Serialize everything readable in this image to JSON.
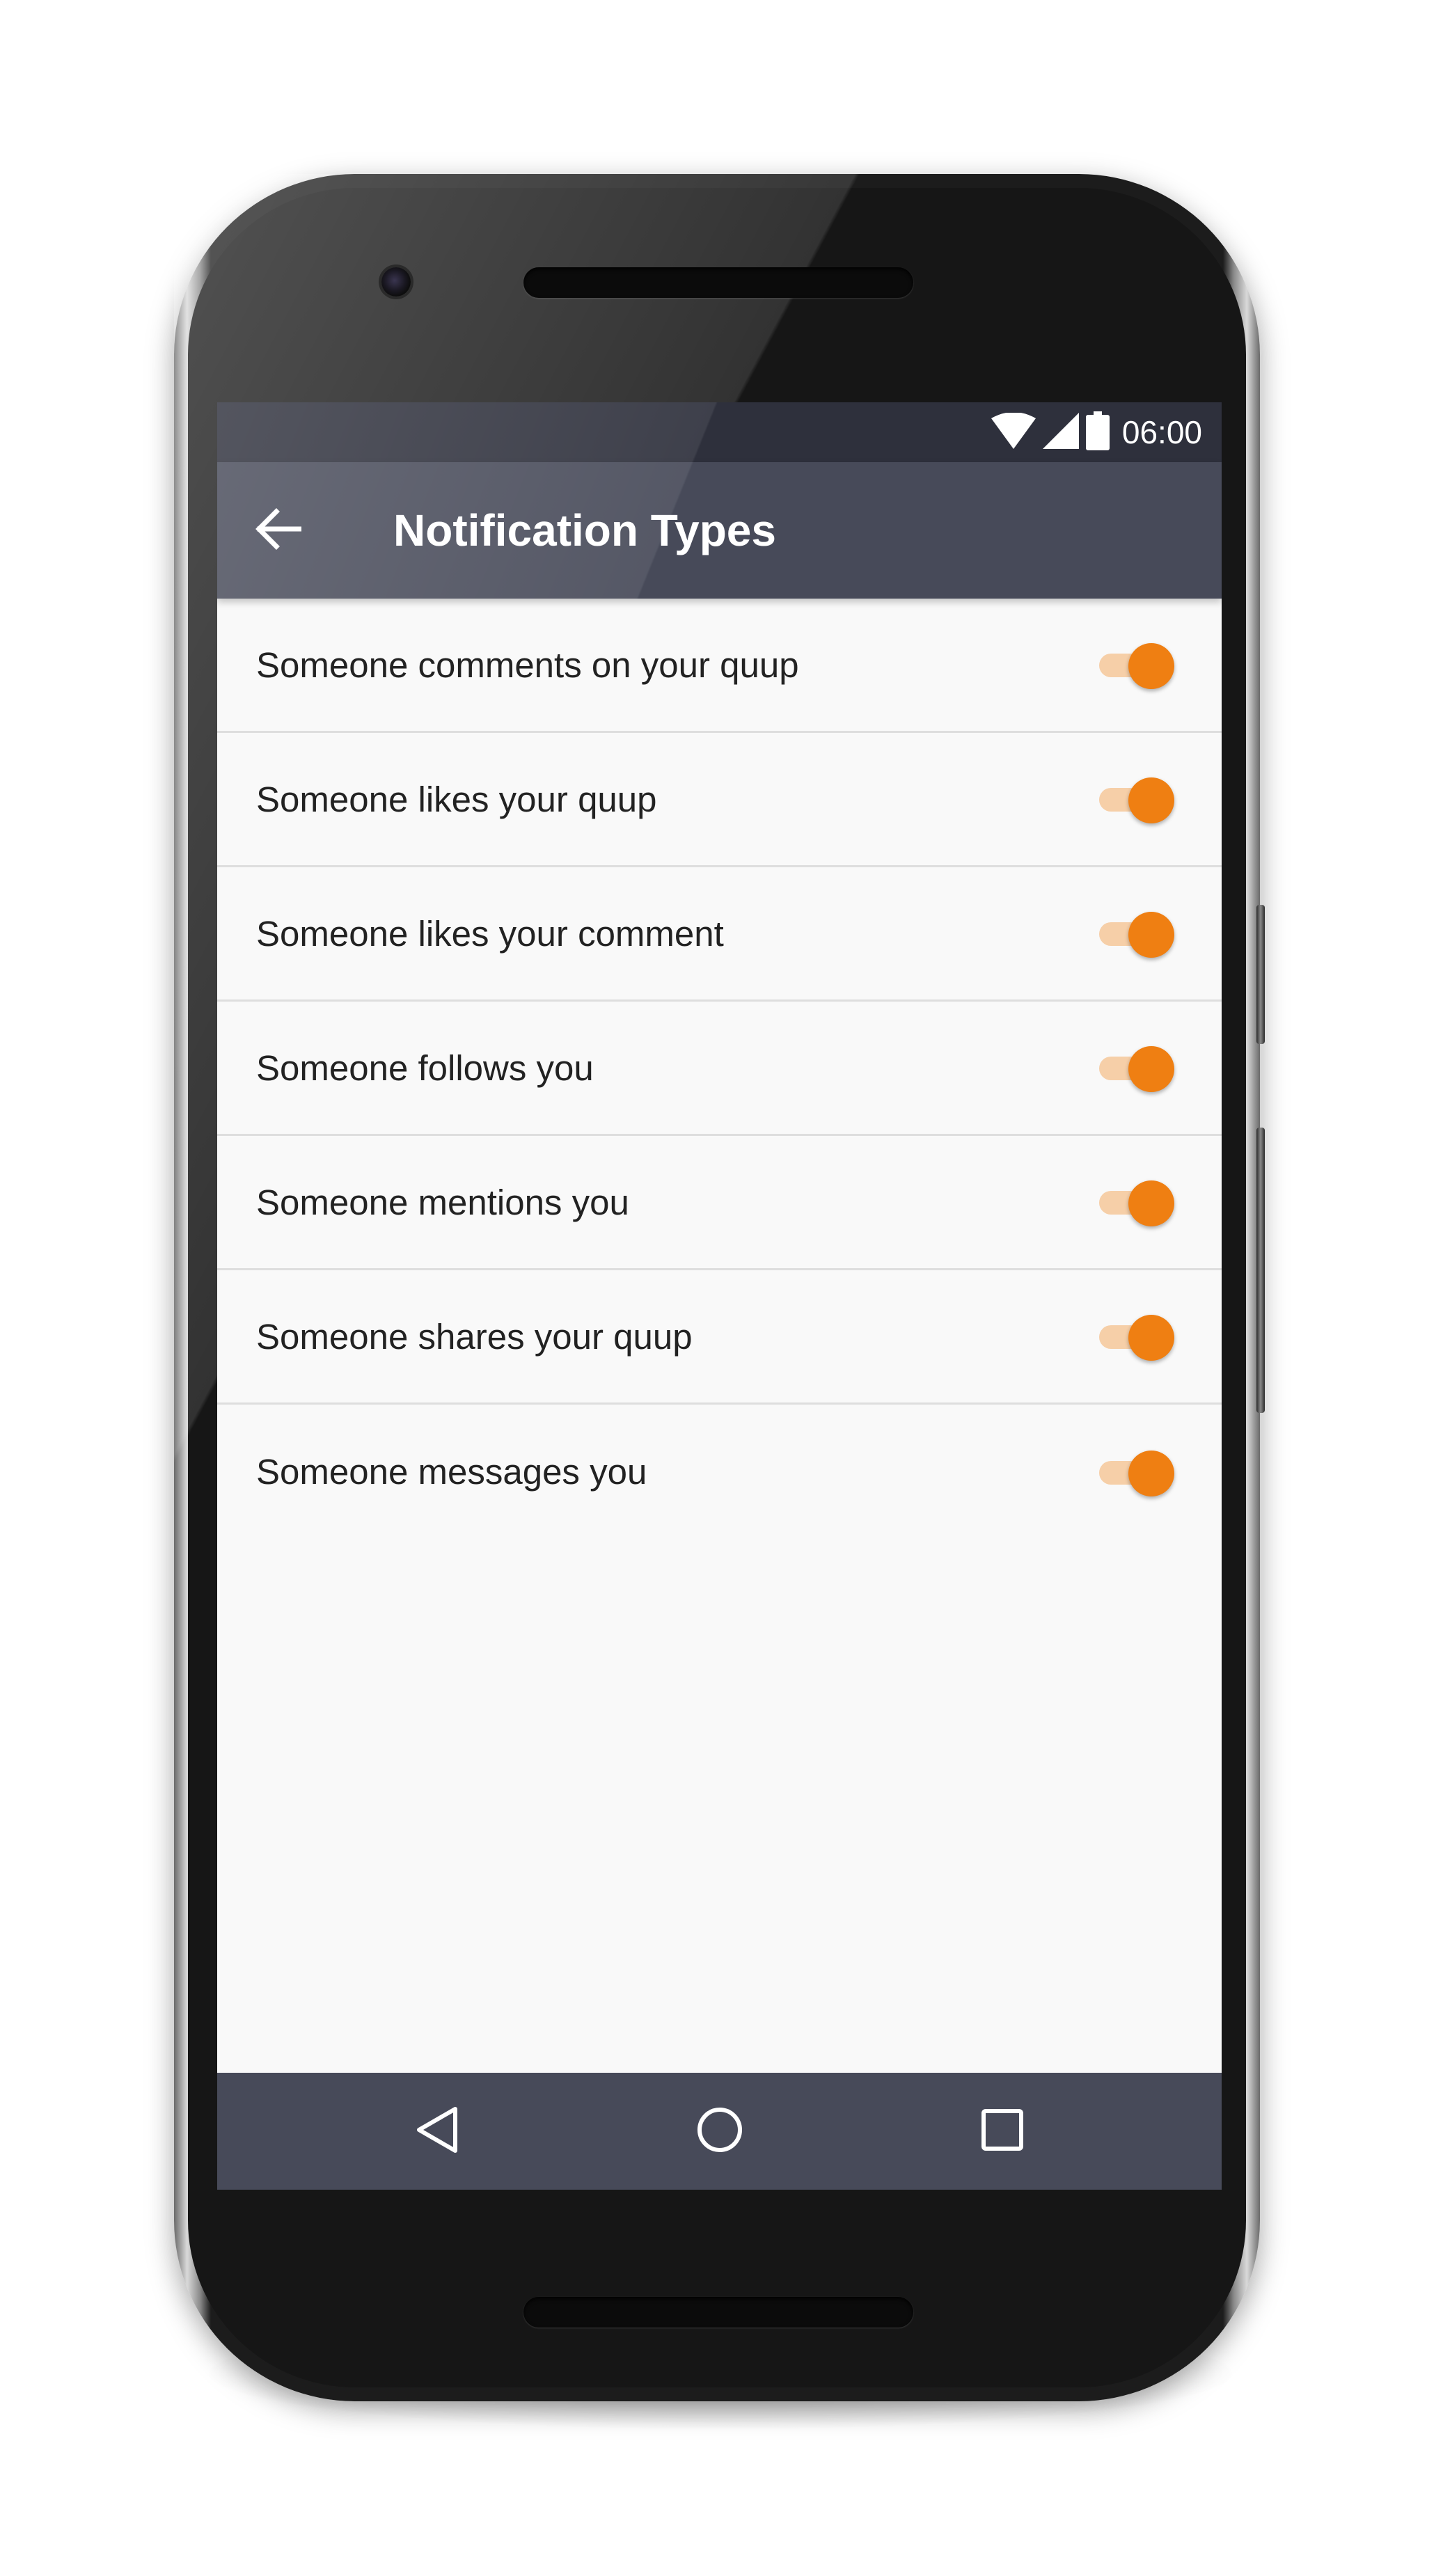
{
  "status_bar": {
    "time": "06:00",
    "icons": [
      "wifi-icon",
      "cell-signal-icon",
      "battery-icon"
    ]
  },
  "app_bar": {
    "back_icon": "arrow-left-icon",
    "title": "Notification Types"
  },
  "settings": [
    {
      "label": "Someone comments on your quup",
      "enabled": true
    },
    {
      "label": "Someone likes your quup",
      "enabled": true
    },
    {
      "label": "Someone likes your comment",
      "enabled": true
    },
    {
      "label": "Someone follows you",
      "enabled": true
    },
    {
      "label": "Someone mentions you",
      "enabled": true
    },
    {
      "label": "Someone shares your quup",
      "enabled": true
    },
    {
      "label": "Someone messages you",
      "enabled": true
    }
  ],
  "nav_bar": {
    "buttons": [
      "back-triangle-icon",
      "home-circle-icon",
      "recents-square-icon"
    ]
  },
  "colors": {
    "status_bar": "#2e303c",
    "app_bar": "#474a59",
    "accent": "#ef7f12",
    "switch_track": "#f6cfa8",
    "background": "#f9f9f9"
  }
}
